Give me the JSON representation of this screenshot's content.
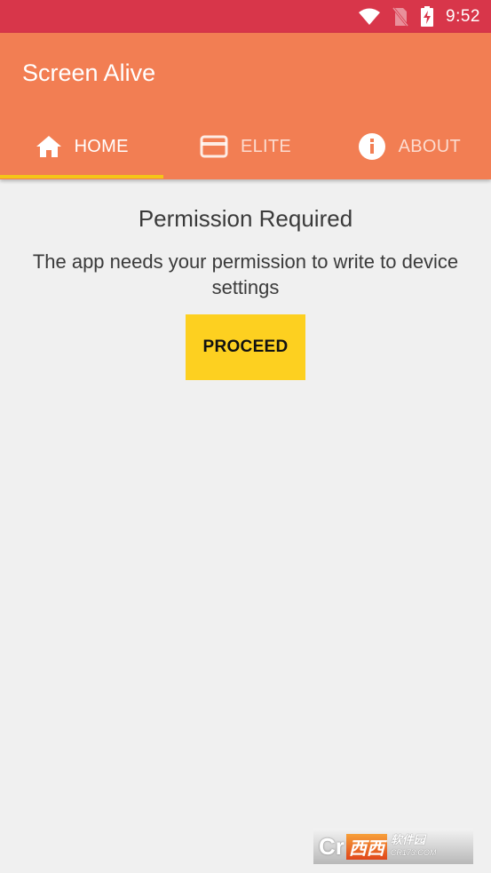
{
  "status_bar": {
    "time": "9:52",
    "icons": [
      "wifi-icon",
      "no-sim-icon",
      "battery-charging-icon"
    ]
  },
  "app_bar": {
    "title": "Screen Alive"
  },
  "tabs": [
    {
      "label": "HOME",
      "icon": "home-icon",
      "active": true
    },
    {
      "label": "ELITE",
      "icon": "credit-card-icon",
      "active": false
    },
    {
      "label": "ABOUT",
      "icon": "info-icon",
      "active": false
    }
  ],
  "main": {
    "heading": "Permission Required",
    "message": "The app needs your permission to write to device settings",
    "proceed_label": "PROCEED"
  },
  "watermark": {
    "logo": "Cr",
    "red_text": "西西",
    "cn_text": "软件园",
    "url": "CR173.COM"
  },
  "colors": {
    "status_bar": "#d8364a",
    "app_bar": "#f27e53",
    "tab_indicator": "#f5c518",
    "proceed_button": "#fdd020",
    "background": "#f0f0f0"
  }
}
